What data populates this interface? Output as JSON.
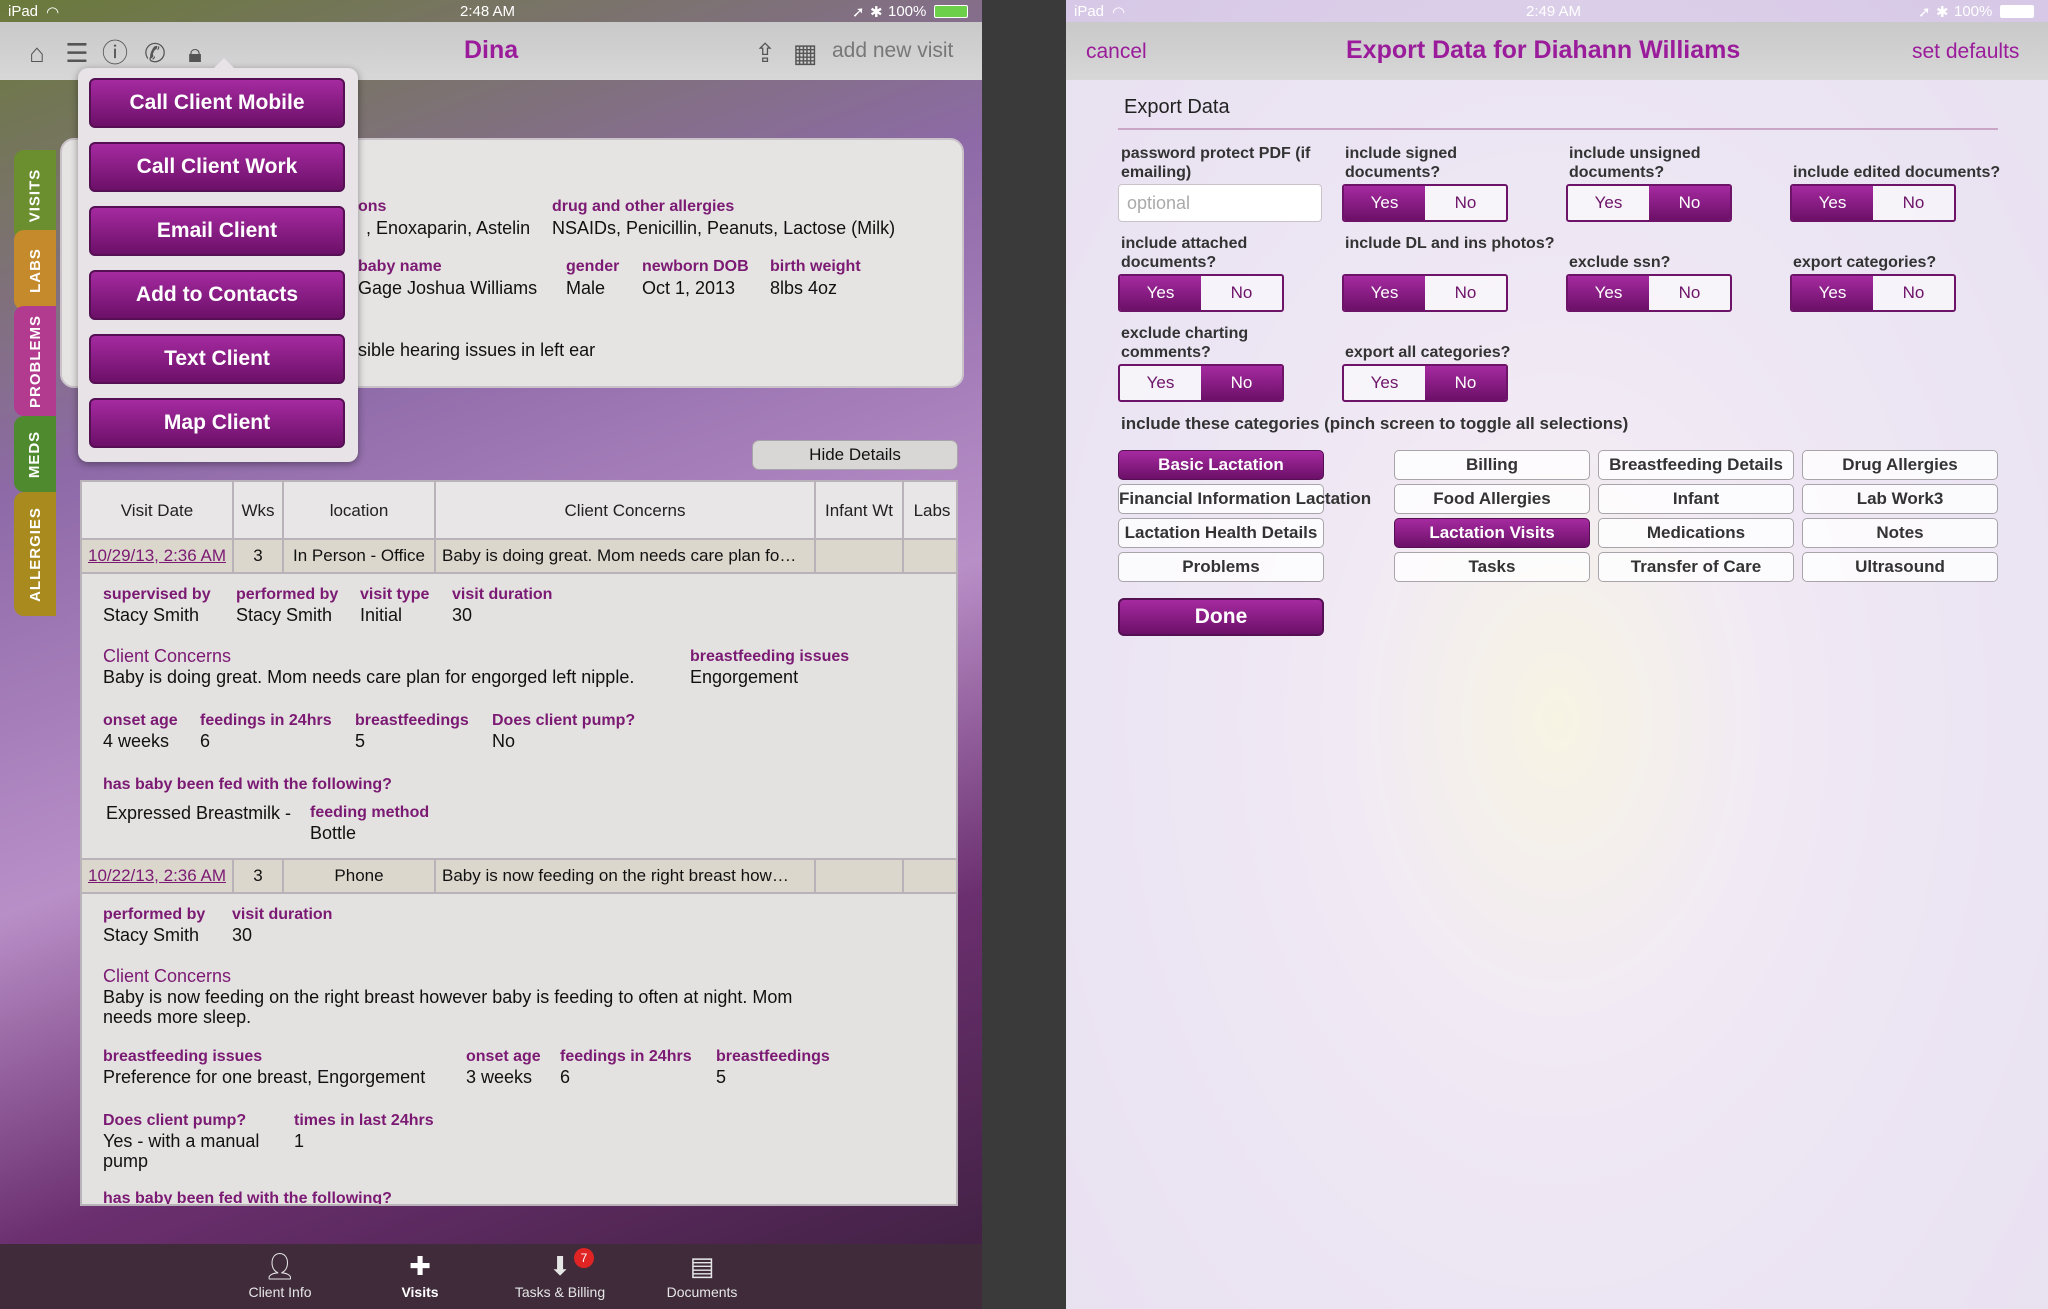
{
  "left": {
    "status": {
      "device": "iPad",
      "time": "2:48 AM",
      "battery": "100%"
    },
    "nav": {
      "title": "Dina",
      "add_visit": "add new visit"
    },
    "side_tabs": [
      "VISITS",
      "LABS",
      "PROBLEMS",
      "MEDS",
      "ALLERGIES"
    ],
    "popover": [
      "Call Client Mobile",
      "Call Client Work",
      "Email Client",
      "Add to Contacts",
      "Text Client",
      "Map Client"
    ],
    "info": {
      "meds_label_tail": "ons",
      "meds_value_tail": ", Enoxaparin, Astelin",
      "allergies_label": "drug and other allergies",
      "allergies_value": "NSAIDs, Penicillin, Peanuts, Lactose (Milk)",
      "baby_name_label": "baby name",
      "baby_name_value": "Gage Joshua Williams",
      "gender_label": "gender",
      "gender_value": "Male",
      "dob_label": "newborn DOB",
      "dob_value": "Oct 1, 2013",
      "weight_label": "birth weight",
      "weight_value": "8lbs 4oz",
      "note_tail": "sible hearing issues in left ear"
    },
    "hide_details": "Hide Details",
    "table": {
      "headers": [
        "Visit Date",
        "Wks",
        "location",
        "Client Concerns",
        "Infant Wt",
        "Labs"
      ],
      "visit1": {
        "date": "10/29/13, 2:36 AM",
        "wks": "3",
        "location": "In Person - Office",
        "concern_short": "Baby is doing great. Mom needs care plan fo…",
        "supervised_by_label": "supervised by",
        "supervised_by": "Stacy Smith",
        "performed_by_label": "performed by",
        "performed_by": "Stacy Smith",
        "visit_type_label": "visit type",
        "visit_type": "Initial",
        "visit_duration_label": "visit duration",
        "visit_duration": "30",
        "concerns_label": "Client Concerns",
        "concerns": "Baby is doing great. Mom needs care plan for engorged left nipple.",
        "issues_label": "breastfeeding issues",
        "issues": "Engorgement",
        "onset_label": "onset age",
        "onset": "4 weeks",
        "feedings_label": "feedings in 24hrs",
        "feedings": "6",
        "bf_label": "breastfeedings",
        "bf": "5",
        "pump_label": "Does client pump?",
        "pump": "No",
        "fed_label": "has baby been fed with the following?",
        "fed_item": "Expressed Breastmilk -",
        "method_label": "feeding method",
        "method": "Bottle"
      },
      "visit2": {
        "date": "10/22/13, 2:36 AM",
        "wks": "3",
        "location": "Phone",
        "concern_short": "Baby is now feeding on the right breast how…",
        "performed_by_label": "performed by",
        "performed_by": "Stacy Smith",
        "visit_duration_label": "visit duration",
        "visit_duration": "30",
        "concerns_label": "Client Concerns",
        "concerns_line1": "Baby is now feeding on the right breast however baby is feeding to often at night.  Mom",
        "concerns_line2": "needs more sleep.",
        "issues_label": "breastfeeding issues",
        "issues": "Preference for one breast, Engorgement",
        "onset_label": "onset age",
        "onset": "3 weeks",
        "feedings_label": "feedings in 24hrs",
        "feedings": "6",
        "bf_label": "breastfeedings",
        "bf": "5",
        "pump_label": "Does client pump?",
        "pump_line1": "Yes - with a manual",
        "pump_line2": "pump",
        "times_label": "times in last 24hrs",
        "times": "1",
        "fed_label": "has baby been fed with the following?"
      }
    },
    "tabbar": [
      {
        "label": "Client Info",
        "icon": "person-icon"
      },
      {
        "label": "Visits",
        "icon": "medkit-icon"
      },
      {
        "label": "Tasks & Billing",
        "icon": "inbox-icon",
        "badge": "7"
      },
      {
        "label": "Documents",
        "icon": "cabinet-icon"
      }
    ]
  },
  "right": {
    "status": {
      "device": "iPad",
      "time": "2:49 AM",
      "battery": "100%"
    },
    "nav": {
      "cancel": "cancel",
      "title": "Export Data for Diahann Williams",
      "set_defaults": "set defaults"
    },
    "section_title": "Export Data",
    "password": {
      "label": "password protect PDF (if emailing)",
      "placeholder": "optional"
    },
    "yes": "Yes",
    "no": "No",
    "options": [
      {
        "label": "include signed documents?",
        "selected": "Yes"
      },
      {
        "label": "include unsigned documents?",
        "selected": "No"
      },
      {
        "label": "include edited documents?",
        "selected": "Yes"
      },
      {
        "label": "include attached documents?",
        "selected": "Yes"
      },
      {
        "label": "include DL and ins photos?",
        "selected": "Yes"
      },
      {
        "label": "exclude ssn?",
        "selected": "Yes"
      },
      {
        "label": "export categories?",
        "selected": "Yes"
      },
      {
        "label": "exclude charting comments?",
        "selected": "No"
      },
      {
        "label": "export all categories?",
        "selected": "No"
      }
    ],
    "categories_label": "include these categories (pinch screen to toggle all selections)",
    "categories": [
      {
        "name": "Basic Lactation",
        "selected": true
      },
      {
        "name": "Billing",
        "selected": false
      },
      {
        "name": "Breastfeeding Details",
        "selected": false
      },
      {
        "name": "Drug Allergies",
        "selected": false
      },
      {
        "name": "Financial Information Lactation",
        "selected": false
      },
      {
        "name": "Food Allergies",
        "selected": false
      },
      {
        "name": "Infant",
        "selected": false
      },
      {
        "name": "Lab Work3",
        "selected": false
      },
      {
        "name": "Lactation Health Details",
        "selected": false
      },
      {
        "name": "Lactation Visits",
        "selected": true
      },
      {
        "name": "Medications",
        "selected": false
      },
      {
        "name": "Notes",
        "selected": false
      },
      {
        "name": "Problems",
        "selected": false
      },
      {
        "name": "Tasks",
        "selected": false
      },
      {
        "name": "Transfer of Care",
        "selected": false
      },
      {
        "name": "Ultrasound",
        "selected": false
      }
    ],
    "done": "Done"
  }
}
